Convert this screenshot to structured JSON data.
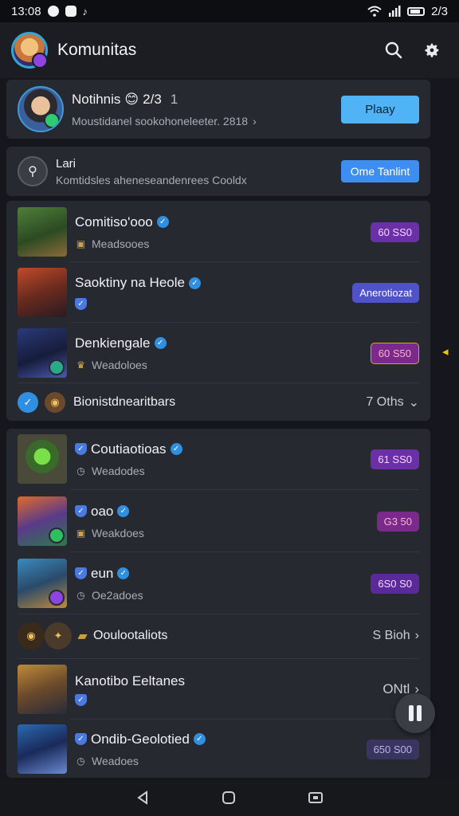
{
  "status_bar": {
    "time": "13:08",
    "right_text": "2/3"
  },
  "app_bar": {
    "title": "Komunitas",
    "search_icon": "search-icon",
    "settings_icon": "gear-icon"
  },
  "profile_card": {
    "name": "Notihnis",
    "emoji": "😊",
    "badge_text": "2/3",
    "rank": "1",
    "subtitle": "Moustidanel sookohoneleeter. 2818",
    "button_label": "Plaay",
    "accent": "#4fb3f5"
  },
  "lab_row": {
    "title": "Lari",
    "subtitle": "Komtidsles aheneseandenrees Cooldx",
    "button_label": "Ome Tanlint"
  },
  "group1": [
    {
      "title": "Comitiso'ooo",
      "badge": "verified",
      "sub_icon": "chest",
      "sub": "Meadsooes",
      "pill": "60 SS0",
      "pill_style": "purple"
    },
    {
      "title": "Saoktiny na Heole",
      "badge": "verified",
      "sub_icon": "shield",
      "sub": "",
      "pill": "Anerotiozat",
      "pill_style": "blueviolet"
    },
    {
      "title": "Denkiengale",
      "badge": "verified",
      "sub_icon": "crown",
      "sub": "Weadoloes",
      "pill": "60 S50",
      "pill_style": "magenta"
    }
  ],
  "section1": {
    "label": "Bionistdnearitbars",
    "count": "7 Oths"
  },
  "group2": [
    {
      "title": "Coutiaotioas",
      "badge": "verified",
      "sub_icon": "clock",
      "sub": "Weadodes",
      "pill": "61 SS0",
      "pill_style": "purple"
    },
    {
      "title": "oao",
      "badge": "verified",
      "sub_icon": "chest",
      "sub": "Weakdoes",
      "pill": "G3 50",
      "pill_style": "magenta"
    },
    {
      "title": "eun",
      "badge": "verified",
      "sub_icon": "clock",
      "sub": "Oe2adoes",
      "pill": "6S0 S0",
      "pill_style": "purple2"
    }
  ],
  "section2": {
    "label": "Ooulootaliots",
    "count": "S Bioh"
  },
  "section3": {
    "label": "Kanotibo Eeltanes",
    "count": "ONtl"
  },
  "last_item": {
    "title": "Ondib-Geolotied",
    "badge": "verified",
    "sub_icon": "clock",
    "sub": "Weadoes",
    "pill": "650 S00",
    "pill_style": "dim"
  }
}
